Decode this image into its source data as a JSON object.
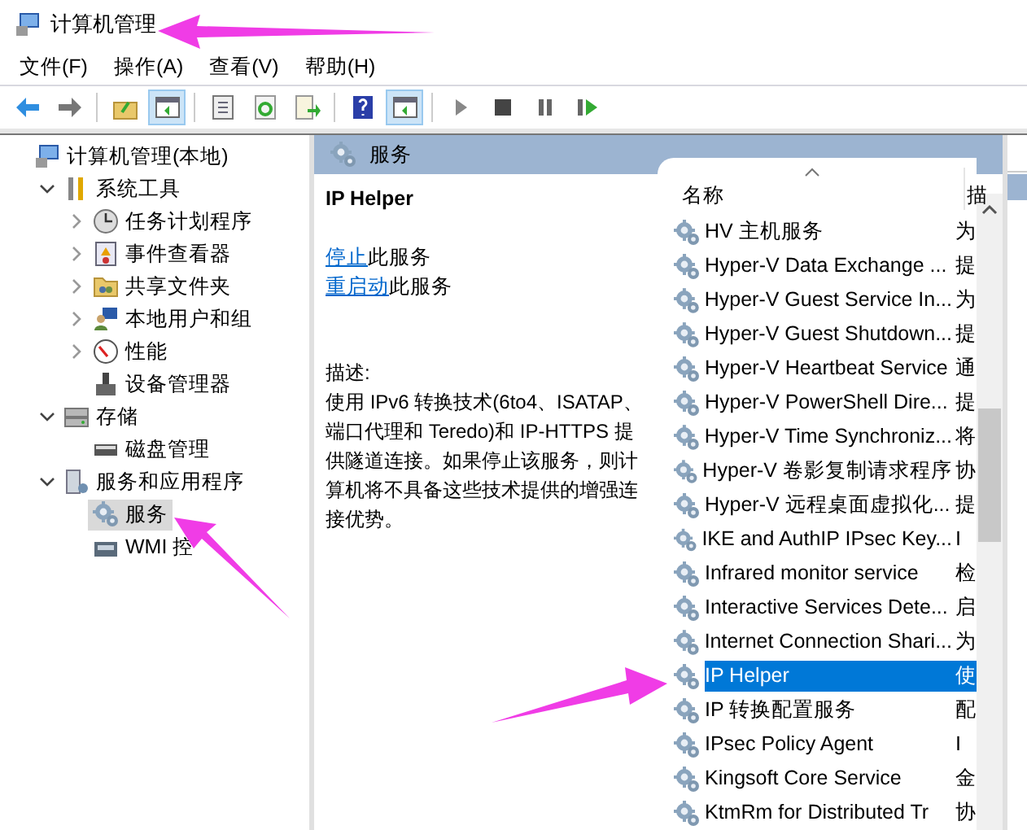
{
  "window": {
    "title": "计算机管理"
  },
  "menu": [
    "文件(F)",
    "操作(A)",
    "查看(V)",
    "帮助(H)"
  ],
  "toolbar": [
    {
      "kind": "back",
      "pressed": false
    },
    {
      "kind": "forward",
      "pressed": false
    },
    {
      "kind": "sep"
    },
    {
      "kind": "up",
      "pressed": false
    },
    {
      "kind": "tree",
      "pressed": true
    },
    {
      "kind": "sep"
    },
    {
      "kind": "properties",
      "pressed": false
    },
    {
      "kind": "refresh",
      "pressed": false
    },
    {
      "kind": "export",
      "pressed": false
    },
    {
      "kind": "sep"
    },
    {
      "kind": "help",
      "pressed": false
    },
    {
      "kind": "actionpane",
      "pressed": true
    },
    {
      "kind": "sep"
    },
    {
      "kind": "play",
      "pressed": false
    },
    {
      "kind": "stop",
      "pressed": false
    },
    {
      "kind": "pause",
      "pressed": false
    },
    {
      "kind": "resume",
      "pressed": false
    }
  ],
  "tree": [
    {
      "label": "计算机管理(本地)",
      "kind": "computer",
      "selected": false,
      "children": [
        {
          "label": "系统工具",
          "kind": "tools",
          "expanded": true,
          "selected": false,
          "children": [
            {
              "label": "任务计划程序",
              "kind": "clock",
              "expanded": false,
              "selected": false
            },
            {
              "label": "事件查看器",
              "kind": "log",
              "expanded": false,
              "selected": false
            },
            {
              "label": "共享文件夹",
              "kind": "folder",
              "expanded": false,
              "selected": false
            },
            {
              "label": "本地用户和组",
              "kind": "users",
              "expanded": false,
              "selected": false
            },
            {
              "label": "性能",
              "kind": "gauge",
              "expanded": false,
              "selected": false
            },
            {
              "label": "设备管理器",
              "kind": "device",
              "selected": false
            }
          ]
        },
        {
          "label": "存储",
          "kind": "storage",
          "expanded": true,
          "selected": false,
          "children": [
            {
              "label": "磁盘管理",
              "kind": "disk",
              "selected": false
            }
          ]
        },
        {
          "label": "服务和应用程序",
          "kind": "server",
          "expanded": true,
          "selected": false,
          "children": [
            {
              "label": "服务",
              "kind": "gear",
              "selected": true
            },
            {
              "label": "WMI 控",
              "kind": "wmi",
              "selected": false
            }
          ]
        }
      ]
    }
  ],
  "services_pane": {
    "title": "服务",
    "detail": {
      "name": "IP Helper",
      "actions": [
        {
          "link": "停止",
          "text": "此服务"
        },
        {
          "link": "重启动",
          "text": "此服务"
        }
      ],
      "description_label": "描述:",
      "description": "使用 IPv6 转换技术(6to4、ISATAP、端口代理和 Teredo)和 IP-HTTPS 提供隧道连接。如果停止该服务，则计算机将不具备这些技术提供的增强连接优势。"
    },
    "table": {
      "columns": [
        "名称",
        "描"
      ],
      "rows": [
        {
          "name": "HV 主机服务",
          "column_2": "为",
          "selected": false
        },
        {
          "name": "Hyper-V Data Exchange ...",
          "column_2": "提",
          "selected": false
        },
        {
          "name": "Hyper-V Guest Service In...",
          "column_2": "为",
          "selected": false
        },
        {
          "name": "Hyper-V Guest Shutdown...",
          "column_2": "提",
          "selected": false
        },
        {
          "name": "Hyper-V Heartbeat Service",
          "column_2": "通",
          "selected": false
        },
        {
          "name": "Hyper-V PowerShell Dire...",
          "column_2": "提",
          "selected": false
        },
        {
          "name": "Hyper-V Time Synchroniz...",
          "column_2": "将",
          "selected": false
        },
        {
          "name": "Hyper-V 卷影复制请求程序",
          "column_2": "协",
          "selected": false
        },
        {
          "name": "Hyper-V 远程桌面虚拟化...",
          "column_2": "提",
          "selected": false
        },
        {
          "name": "IKE and AuthIP IPsec Key...",
          "column_2": "I",
          "selected": false
        },
        {
          "name": "Infrared monitor service",
          "column_2": "检",
          "selected": false
        },
        {
          "name": "Interactive Services Dete...",
          "column_2": "启",
          "selected": false
        },
        {
          "name": "Internet Connection Shari...",
          "column_2": "为",
          "selected": false
        },
        {
          "name": "IP Helper",
          "column_2": "使",
          "selected": true
        },
        {
          "name": "IP 转换配置服务",
          "column_2": "配",
          "selected": false
        },
        {
          "name": "IPsec Policy Agent",
          "column_2": "I",
          "selected": false
        },
        {
          "name": "Kingsoft Core Service",
          "column_2": "金",
          "selected": false
        },
        {
          "name": "KtmRm for Distributed Tr",
          "column_2": "协",
          "selected": false
        }
      ]
    }
  }
}
